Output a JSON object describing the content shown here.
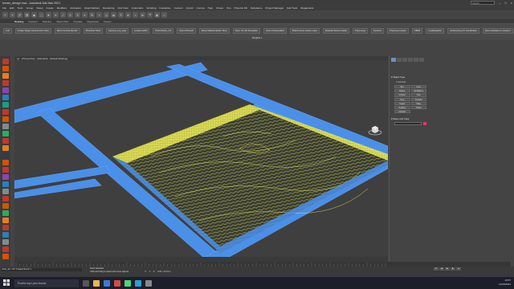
{
  "window": {
    "title": "terrain_design.max - Autodesk 3ds Max 2021",
    "search_placeholder": "Search",
    "workspace_label": "Workspaces:",
    "workspace_value": "Default"
  },
  "menu": [
    "File",
    "Edit",
    "Tools",
    "Group",
    "Views",
    "Create",
    "Modifiers",
    "Animation",
    "Graph Editors",
    "Rendering",
    "Civil View",
    "Customize",
    "Scripting",
    "Interactive",
    "Content",
    "Arnold",
    "Corona",
    "Help",
    "Chaos",
    "iToo",
    "Phoenix FD",
    "Substance",
    "Project Manager",
    "Salt Tools",
    "Megascans"
  ],
  "toolbar": [
    "↶",
    "↷",
    "🔗",
    "⛓",
    "▣",
    "⬚",
    "✥",
    "⟳",
    "⤢",
    "⚲",
    "3",
    "∠",
    "%",
    "⌖",
    "◫",
    "▤",
    "☰",
    "⊞",
    "◐",
    "⚙",
    "🎬",
    "▦",
    "⌂"
  ],
  "ribbon_tabs": [
    "Modeling",
    "Freeform",
    "Selection",
    "Object Paint",
    "Populate",
    "Megascans",
    "Cleaner"
  ],
  "shelf": {
    "buttons": [
      "Cull",
      "Create Target Camera from View",
      "Bert's Corona Render",
      "Photoline Tools",
      "Camera_exp_angl",
      "Loukas toolkit",
      "PhotoTextify_CS",
      "Open iPhoneD",
      "Reset Material Editor Slots",
      "Open Viz 3D Simulation",
      "Open Polyvisualize",
      "BrainCorona render maps",
      "Material Texture loader",
      "Polymerge",
      "Dynamo",
      "Polycloner plugin",
      "OBHP",
      "msqtNeighbor",
      "randomizing UV coordinates",
      "Save hardware to viewport"
    ],
    "label": "Tangible 1"
  },
  "viewport": {
    "label_plus": "[+]",
    "label_view": "[Perspective]",
    "label_shading": "[Standard]",
    "label_style": "[Default Shading]",
    "frame_colors": {
      "frame": "#4a8fe8",
      "terrain_lines": "#e8e84a",
      "terrain_bg": "#3a3d35"
    }
  },
  "panel": {
    "section1": "Object Type",
    "autogrid": "AutoGrid",
    "objects": [
      "Box",
      "Cone",
      "Sphere",
      "GeoSphere",
      "Cylinder",
      "Tube",
      "Torus",
      "Pyramid",
      "Teapot",
      "Plane",
      "TextPlus",
      "Hedra",
      "Chamfer"
    ],
    "section2": "Name and Color"
  },
  "status": {
    "maxscript": "$.tex_ab = #C \"Created Event\" s",
    "selected": "None Selected",
    "hint": "Click and drag to select and move objects",
    "coords": {
      "x_label": "X:",
      "y_label": "Y:",
      "z_label": "Z:",
      "grid": "Grid = 10.0cm"
    },
    "frame": "0 / 100",
    "time_label": "Add Time Tag"
  },
  "taskbar": {
    "search": "Escribe aquí para buscar",
    "time": "13:57",
    "date": "12/05/2021"
  }
}
